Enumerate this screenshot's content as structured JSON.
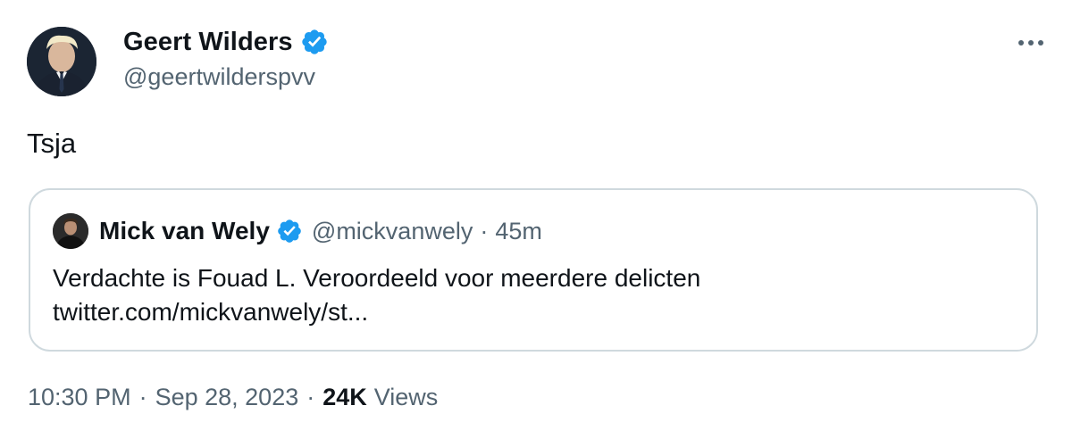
{
  "author": {
    "name": "Geert Wilders",
    "handle": "@geertwilderspvv",
    "verified": true,
    "avatar_icon": "profile-photo"
  },
  "tweet": {
    "text": "Tsja"
  },
  "quoted_tweet": {
    "name": "Mick van Wely",
    "handle": "@mickvanwely",
    "separator": "·",
    "time_ago": "45m",
    "verified": true,
    "text_line1": "Verdachte is Fouad L. Veroordeeld voor meerdere delicten",
    "link": "twitter.com/mickvanwely/st..."
  },
  "meta": {
    "time": "10:30 PM",
    "separator": "·",
    "date": "Sep 28, 2023",
    "views_count": "24K",
    "views_label": "Views"
  },
  "colors": {
    "verified_blue": "#1d9bf0",
    "secondary_text": "#536471",
    "primary_text": "#0f1419",
    "border": "#cfd9de"
  },
  "icons": {
    "more": "more-horizontal-icon",
    "verified": "verified-badge-icon"
  }
}
